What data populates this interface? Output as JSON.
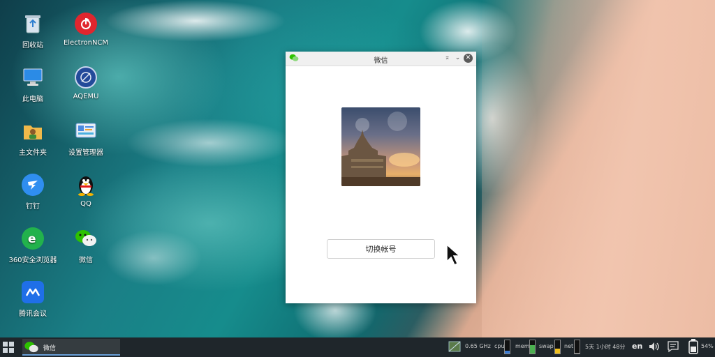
{
  "desktop": {
    "icons": [
      {
        "label": "回收站",
        "icon": "recycle-bin-icon"
      },
      {
        "label": "ElectronNCM",
        "icon": "netease-music-icon"
      },
      {
        "label": "此电脑",
        "icon": "computer-icon"
      },
      {
        "label": "AQEMU",
        "icon": "aqemu-icon"
      },
      {
        "label": "主文件夹",
        "icon": "home-folder-icon"
      },
      {
        "label": "设置管理器",
        "icon": "settings-manager-icon"
      },
      {
        "label": "钉钉",
        "icon": "dingtalk-icon"
      },
      {
        "label": "QQ",
        "icon": "qq-penguin-icon"
      },
      {
        "label": "360安全浏览器",
        "icon": "360-browser-icon"
      },
      {
        "label": "微信",
        "icon": "wechat-icon"
      },
      {
        "label": "腾讯会议",
        "icon": "tencent-meeting-icon"
      }
    ]
  },
  "window": {
    "title": "微信",
    "switch_account_label": "切换帐号"
  },
  "taskbar": {
    "task_label": "微信",
    "cpu_freq": "0.65 GHz",
    "cpu_label": "cpu",
    "mem_label": "mem",
    "swap_label": "swap",
    "net_label": "net",
    "uptime": "5天 1小时 48分",
    "lang": "en",
    "battery": "54%"
  },
  "colors": {
    "wechat_green": "#2dc100",
    "cpu_meter": "#3a7bd5",
    "mem_meter": "#4caf50",
    "swap_meter": "#f0c020"
  }
}
